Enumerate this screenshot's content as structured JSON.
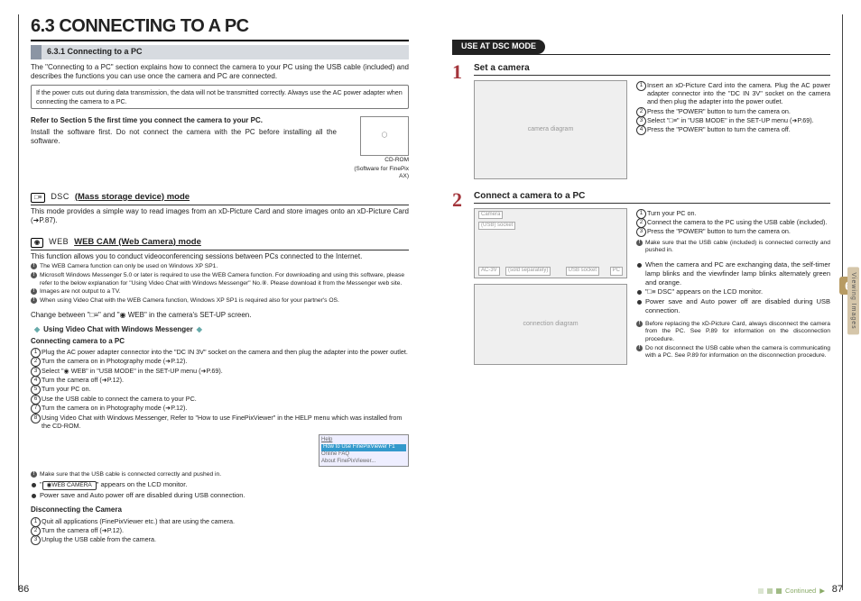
{
  "left": {
    "section_title": "6.3 CONNECTING TO A PC",
    "sub1": "6.3.1 Connecting to a PC",
    "intro": "The \"Connecting to a PC\" section explains how to connect the camera to your PC using the USB cable (included) and describes the functions you can use once the camera and PC are connected.",
    "powerNote": "If the power cuts out during data transmission, the data will not be transmitted correctly. Always use the AC power adapter when connecting the camera to a PC.",
    "firstTimeBold": "Refer to Section 5 the first time you connect the camera to your PC.",
    "firstTimeBody": "Install the software first. Do not connect the camera with the PC before installing all the software.",
    "cdromLabel": "CD-ROM",
    "cdromSub": "(Software for FinePix AX)",
    "mode1Icon": "□≡",
    "mode1Pre": "DSC",
    "mode1Heading": "(Mass storage device) mode",
    "mode1Body": "This mode provides a simple way to read images from an xD-Picture Card and store images onto an xD-Picture Card (➜P.87).",
    "mode2Icon": "◉",
    "mode2Pre": "WEB",
    "mode2Heading": "WEB CAM (Web Camera) mode",
    "mode2Body": "This function allows you to conduct videoconferencing sessions between PCs connected to the Internet.",
    "webNotes": [
      "The WEB Camera function can only be used on Windows XP SP1.",
      "Microsoft Windows Messenger 5.0 or later is required to use the WEB Camera function. For downloading and using this software, please refer to the below explanation for \"Using Video Chat with Windows Messenger\" No.⑧. Please download it from the Messenger web site.",
      "Images are not output to a TV.",
      "When using Video Chat with the WEB Camera function, Windows XP SP1 is required also for your partner's OS."
    ],
    "changeLine": "Change between \"□≡\" and \"◉ WEB\" in the camera's SET-UP screen.",
    "vcHeading": "Using Video Chat with Windows Messenger",
    "vcSub": "Connecting camera to a PC",
    "vcSteps": [
      [
        "1",
        "Plug the AC power adapter connector into the \"DC IN 3V\" socket on the camera and then plug the adapter into the power outlet."
      ],
      [
        "2",
        "Turn the camera on in Photography mode (➜P.12)."
      ],
      [
        "3",
        "Select \"◉ WEB\" in \"USB MODE\" in the SET-UP menu (➜P.69)."
      ],
      [
        "4",
        "Turn the camera off (➜P.12)."
      ],
      [
        "5",
        "Turn your PC on."
      ],
      [
        "6",
        "Use the USB cable to connect the camera to your PC."
      ],
      [
        "7",
        "Turn the camera on in Photography mode (➜P.12)."
      ],
      [
        "8",
        "Using Video Chat with Windows Messenger, Refer to \"How to use FinePixViewer\" in the HELP menu which was installed from the CD-ROM."
      ]
    ],
    "usbNote": "Make sure that the USB cable is connected correctly and pushed in.",
    "lcdChip": "◉WEB CAMERA",
    "vcBullets": [
      "\"{lcd}\" appears on the LCD monitor.",
      "Power save and Auto power off are disabled during USB connection."
    ],
    "discHeading": "Disconnecting the Camera",
    "discSteps": [
      [
        "1",
        "Quit all applications (FinePixViewer etc.) that are using the camera."
      ],
      [
        "2",
        "Turn the camera off (➜P.12)."
      ],
      [
        "3",
        "Unplug the USB cable from the camera."
      ]
    ],
    "pageNum": "86"
  },
  "right": {
    "pill": "USE AT DSC MODE",
    "step1": {
      "num": "1",
      "title": "Set a camera",
      "items": [
        [
          "1",
          "Insert an xD-Picture Card into the camera. Plug the AC power adapter connector into the \"DC IN 3V\" socket on the camera and then plug the adapter into the power outlet."
        ],
        [
          "2",
          "Press the \"POWER\" button to turn the camera on."
        ],
        [
          "3",
          "Select \"□≡\" in \"USB MODE\" in the SET-UP menu (➜P.69)."
        ],
        [
          "4",
          "Press the \"POWER\" button to turn the camera off."
        ]
      ]
    },
    "step2": {
      "num": "2",
      "title": "Connect a camera to a PC",
      "items": [
        [
          "1",
          "Turn your PC on."
        ],
        [
          "2",
          "Connect the camera to the PC using the USB cable (included)."
        ],
        [
          "3",
          "Press the \"POWER\" button to turn the camera on."
        ]
      ],
      "usbNote": "Make sure that the USB cable (included) is connected correctly and pushed in.",
      "bullets": [
        "When the camera and PC are exchanging data, the self-timer lamp blinks and the viewfinder lamp blinks alternately green and orange.",
        "\"□≡ DSC\" appears on the LCD monitor.",
        "Power save and Auto power off are disabled during USB connection."
      ],
      "cautions": [
        "Before replacing the xD-Picture Card, always disconnect the camera from the PC. See P.89 for information on the disconnection procedure.",
        "Do not disconnect the USB cable when the camera is communicating with a PC. See P.89 for information on the disconnection procedure."
      ],
      "figLabels": {
        "camera": "Camera",
        "usbSock": "(USB) socket",
        "ac3v": "AC-3V",
        "soldSep": "(sold separately)",
        "usbSocket": "USB socket",
        "pc": "PC"
      }
    },
    "sideTab": "Viewing Images",
    "big6": "6",
    "continued": "Continued",
    "pageNum": "87"
  },
  "helpMenu": {
    "title": "Help",
    "i1": "How to Use FinePixViewer   F1",
    "i2": "Online FAQ",
    "i3": "About FinePixViewer..."
  }
}
